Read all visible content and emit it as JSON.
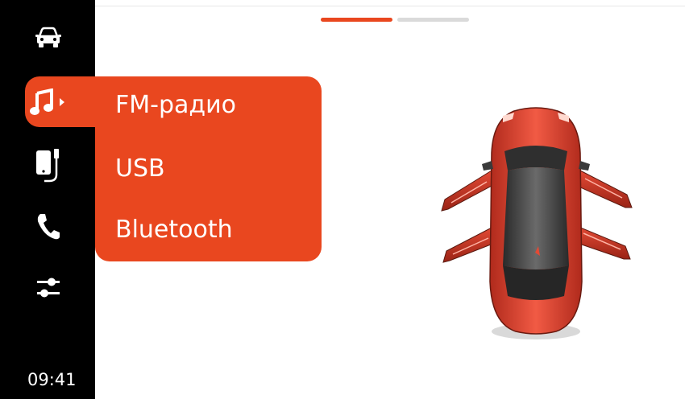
{
  "sidebar": {
    "items": [
      {
        "icon": "car-icon"
      },
      {
        "icon": "music-note-icon",
        "active": true
      },
      {
        "icon": "phone-usb-icon"
      },
      {
        "icon": "phone-call-icon"
      },
      {
        "icon": "sliders-icon"
      }
    ],
    "clock": "09:41"
  },
  "pager": {
    "pages": 2,
    "active_index": 0
  },
  "source_menu": {
    "items": [
      "FM-радио",
      "USB",
      "Bluetooth"
    ]
  },
  "colors": {
    "accent": "#e9471f",
    "sidebar_bg": "#000000",
    "pager_inactive": "#dadada",
    "car_body": "#e9472e",
    "car_roof": "#3c3c3c"
  },
  "vehicle": {
    "doors_open": [
      "front-left",
      "front-right",
      "rear-left",
      "rear-right"
    ]
  }
}
